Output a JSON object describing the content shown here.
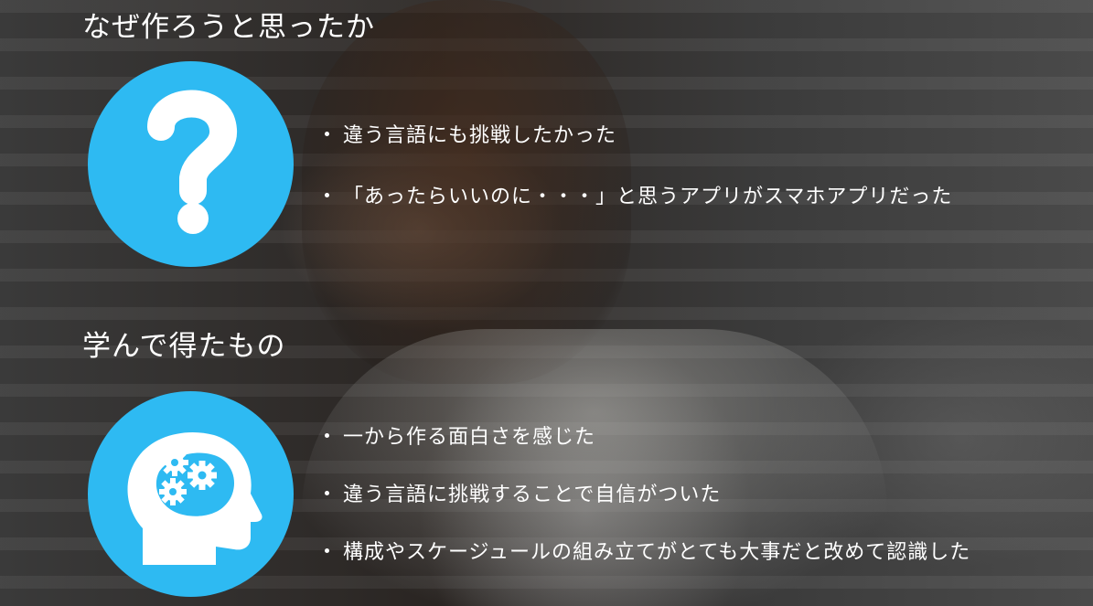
{
  "sections": [
    {
      "heading": "なぜ作ろうと思ったか",
      "icon": "question-mark-icon",
      "bullets": [
        "違う言語にも挑戦したかった",
        "「あったらいいのに・・・」と思うアプリがスマホアプリだった"
      ]
    },
    {
      "heading": "学んで得たもの",
      "icon": "head-gears-icon",
      "bullets": [
        "一から作る面白さを感じた",
        "違う言語に挑戦することで自信がついた",
        "構成やスケージュールの組み立てがとても大事だと改めて認識した"
      ]
    }
  ],
  "colors": {
    "accent": "#2ebaf2",
    "text": "#ffffff"
  }
}
